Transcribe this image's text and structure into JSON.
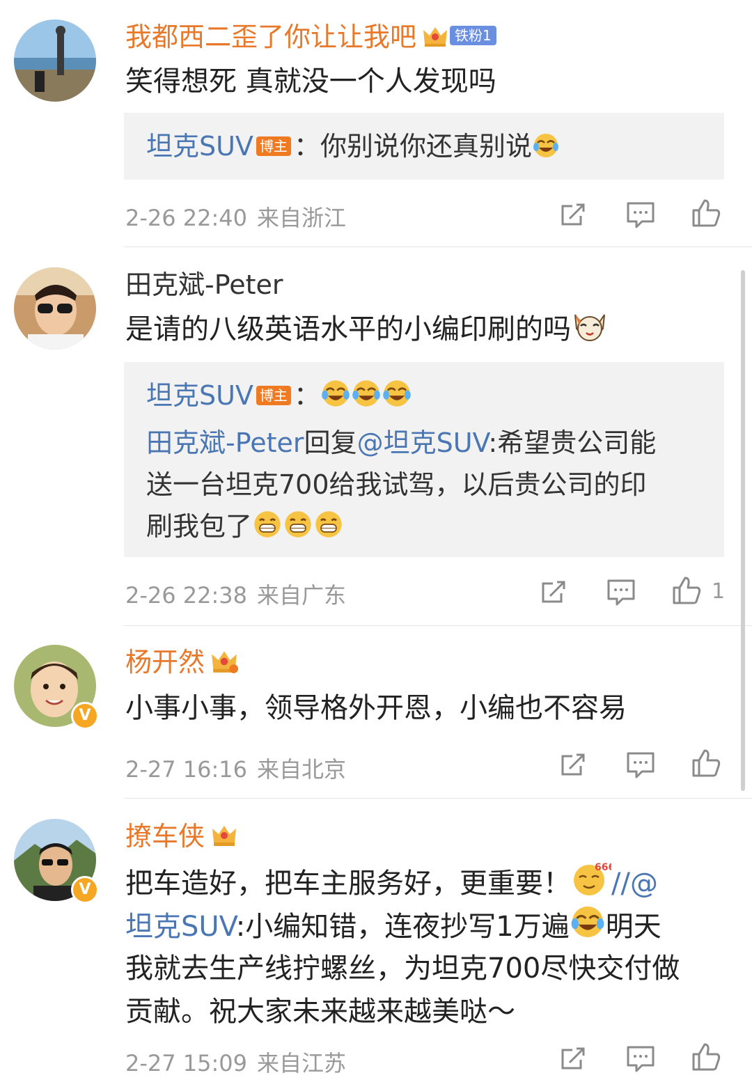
{
  "comments": [
    {
      "name": "我都西二歪了你让让我吧",
      "fan_badge": "铁粉1",
      "text": "笑得想死 真就没一个人发现吗",
      "reply": {
        "author": "坦克SUV",
        "author_badge": "博主",
        "sep": "：",
        "text": "你别说你还真别说"
      },
      "time": "2-26 22:40",
      "location": "来自浙江"
    },
    {
      "name": "田克斌-Peter",
      "text": "是请的八级英语水平的小编印刷的吗",
      "reply": {
        "author": "坦克SUV",
        "author_badge": "博主",
        "sep": "：",
        "sub_author": "田克斌-Peter",
        "sub_mid": "回复",
        "sub_mention": "@坦克SUV",
        "sub_text1": ":希望贵公司能",
        "sub_text2": "送一台坦克700给我试驾，以后贵公司的印",
        "sub_text3": "刷我包了"
      },
      "time": "2-26 22:38",
      "location": "来自广东",
      "likes": "1"
    },
    {
      "name": "杨开然",
      "text": "小事小事，领导格外开恩，小编也不容易",
      "time": "2-27 16:16",
      "location": "来自北京"
    },
    {
      "name": "撩车侠",
      "text_line1": "把车造好，把车主服务好，更重要！",
      "text_line1_tail": "//@",
      "text_line2_mention": "坦克SUV",
      "text_line2": ":小编知错，连夜抄写1万遍",
      "text_line2_tail": "明天",
      "text_line3": "我就去生产线拧螺丝，为坦克700尽快交付做",
      "text_line4": "贡献。祝大家未来越来越美哒～",
      "time": "2-27 15:09",
      "location": "来自江苏"
    }
  ],
  "colors": {
    "name_orange": "#e8782a",
    "link_blue": "#4a77b4",
    "meta_gray": "#999999",
    "badge_orange": "#f07a22",
    "fan_badge_blue": "#6b8fe0",
    "verified_yellow": "#f5a623"
  },
  "icons": [
    "share-icon",
    "comment-icon",
    "like-icon",
    "crown-icon",
    "laugh-cry-emoji",
    "grin-emoji",
    "cat-emoji",
    "666-emoji"
  ]
}
